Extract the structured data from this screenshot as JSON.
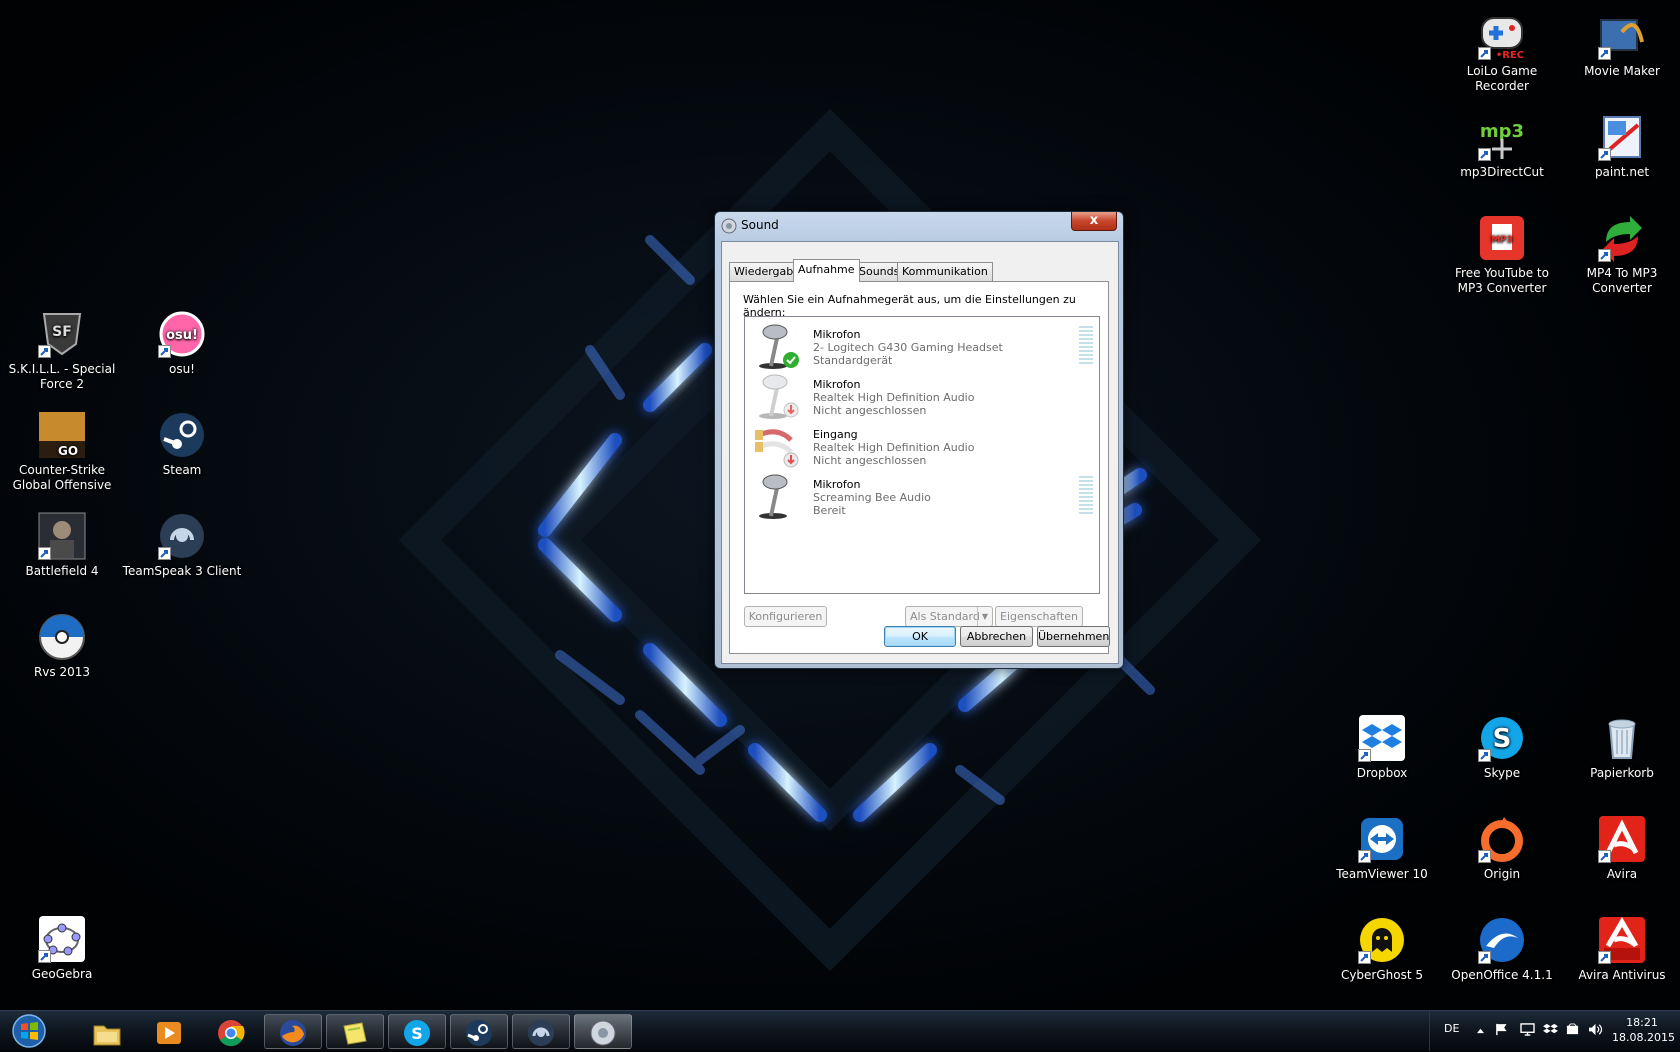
{
  "desktop": {
    "left_icons": [
      {
        "label": "S.K.I.L.L. - Special Force 2",
        "icon": "skill-special-force-icon"
      },
      {
        "label": "osu!",
        "icon": "osu-icon"
      },
      {
        "label": "Counter-Strike Global Offensive",
        "icon": "csgo-icon"
      },
      {
        "label": "Steam",
        "icon": "steam-icon"
      },
      {
        "label": "Battlefield 4",
        "icon": "battlefield-icon"
      },
      {
        "label": "TeamSpeak 3 Client",
        "icon": "teamspeak-icon"
      },
      {
        "label": "Rvs 2013",
        "icon": "rvs-icon"
      },
      {
        "label": "GeoGebra",
        "icon": "geogebra-icon"
      }
    ],
    "right_icons": [
      {
        "label": "LoiLo Game Recorder",
        "icon": "loilo-recorder-icon"
      },
      {
        "label": "Movie Maker",
        "icon": "movie-maker-icon"
      },
      {
        "label": "mp3DirectCut",
        "icon": "mp3directcut-icon"
      },
      {
        "label": "paint.net",
        "icon": "paintnet-icon"
      },
      {
        "label": "Free YouTube to MP3 Converter",
        "icon": "youtube-mp3-icon"
      },
      {
        "label": "MP4 To MP3 Converter",
        "icon": "mp4-mp3-icon"
      },
      {
        "label": "Dropbox",
        "icon": "dropbox-icon"
      },
      {
        "label": "Skype",
        "icon": "skype-icon"
      },
      {
        "label": "Papierkorb",
        "icon": "recycle-bin-icon"
      },
      {
        "label": "TeamViewer 10",
        "icon": "teamviewer-icon"
      },
      {
        "label": "Origin",
        "icon": "origin-icon"
      },
      {
        "label": "Avira",
        "icon": "avira-icon"
      },
      {
        "label": "CyberGhost 5",
        "icon": "cyberghost-icon"
      },
      {
        "label": "OpenOffice 4.1.1",
        "icon": "openoffice-icon"
      },
      {
        "label": "Avira Antivirus",
        "icon": "avira-antivirus-icon"
      }
    ]
  },
  "dialog": {
    "title": "Sound",
    "close_glyph": "x",
    "tabs": [
      {
        "label": "Wiedergabe"
      },
      {
        "label": "Aufnahme"
      },
      {
        "label": "Sounds"
      },
      {
        "label": "Kommunikation"
      }
    ],
    "active_tab": "Aufnahme",
    "instruction": "Wählen Sie ein Aufnahmegerät aus, um die Einstellungen zu ändern:",
    "devices": [
      {
        "name": "Mikrofon",
        "description": "2- Logitech G430 Gaming Headset",
        "status": "Standardgerät",
        "icon": "microphone-default-icon"
      },
      {
        "name": "Mikrofon",
        "description": "Realtek High Definition Audio",
        "status": "Nicht angeschlossen",
        "icon": "microphone-unplugged-icon"
      },
      {
        "name": "Eingang",
        "description": "Realtek High Definition Audio",
        "status": "Nicht angeschlossen",
        "icon": "line-in-unplugged-icon"
      },
      {
        "name": "Mikrofon",
        "description": "Screaming Bee Audio",
        "status": "Bereit",
        "icon": "microphone-ready-icon"
      }
    ],
    "buttons": {
      "configure": "Konfigurieren",
      "set_default": "Als Standard",
      "properties": "Eigenschaften",
      "ok": "OK",
      "cancel": "Abbrechen",
      "apply": "Übernehmen"
    }
  },
  "taskbar": {
    "pinned": [
      {
        "icon": "start-orb-icon"
      },
      {
        "icon": "explorer-icon"
      },
      {
        "icon": "media-player-icon"
      },
      {
        "icon": "chrome-icon"
      },
      {
        "icon": "firefox-icon"
      },
      {
        "icon": "sticky-notes-icon"
      },
      {
        "icon": "skype-icon"
      },
      {
        "icon": "steam-icon"
      },
      {
        "icon": "teamspeak-icon"
      },
      {
        "icon": "sound-icon"
      }
    ],
    "tray": {
      "language": "DE",
      "time": "18:21",
      "date": "18.08.2015"
    }
  }
}
